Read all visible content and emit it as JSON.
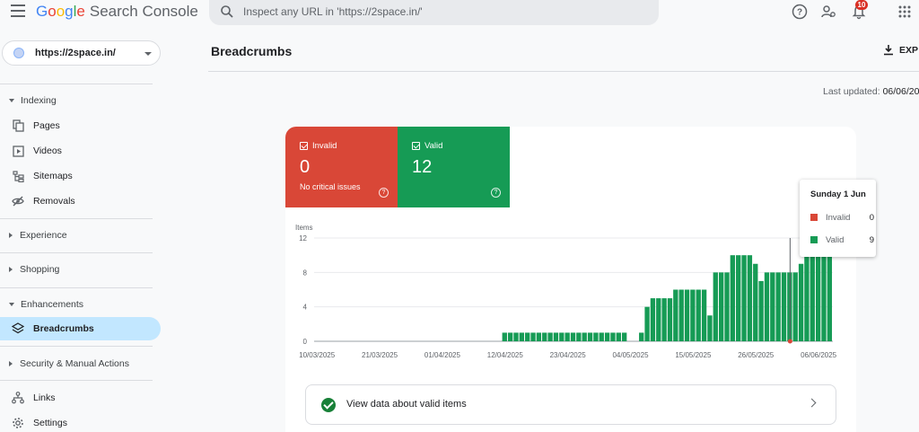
{
  "header": {
    "logo_google": "Google",
    "logo_product": "Search Console",
    "search_placeholder": "Inspect any URL in 'https://2space.in/'",
    "notifications_count": "10"
  },
  "sidebar": {
    "property": "https://2space.in/",
    "sections": {
      "indexing": "Indexing",
      "experience": "Experience",
      "shopping": "Shopping",
      "enhancements": "Enhancements",
      "security": "Security & Manual Actions"
    },
    "items": {
      "pages": "Pages",
      "videos": "Videos",
      "sitemaps": "Sitemaps",
      "removals": "Removals",
      "breadcrumbs": "Breadcrumbs",
      "links": "Links",
      "settings": "Settings"
    }
  },
  "main": {
    "title": "Breadcrumbs",
    "export_label": "EXP",
    "last_updated_label": "Last updated:",
    "last_updated_value": "06/06/20",
    "tiles": {
      "invalid": {
        "label": "Invalid",
        "value": "0",
        "sub": "No critical issues"
      },
      "valid": {
        "label": "Valid",
        "value": "12"
      }
    },
    "tooltip": {
      "date": "Sunday 1 Jun",
      "invalid_label": "Invalid",
      "invalid_value": "0",
      "valid_label": "Valid",
      "valid_value": "9"
    },
    "view_data_label": "View data about valid items"
  },
  "colors": {
    "invalid": "#d94737",
    "valid": "#169b55",
    "accent_active": "#c2e7ff"
  },
  "chart_data": {
    "type": "bar",
    "ylabel": "Items",
    "ylim": [
      0,
      12
    ],
    "yticks": [
      0,
      4,
      8,
      12
    ],
    "xtick_labels": [
      "10/03/2025",
      "21/03/2025",
      "01/04/2025",
      "12/04/2025",
      "23/04/2025",
      "04/05/2025",
      "15/05/2025",
      "26/05/2025",
      "06/06/2025"
    ],
    "start_date": "10/03/2025",
    "series": [
      {
        "name": "Invalid",
        "values": [
          0
        ]
      },
      {
        "name": "Valid",
        "values": [
          0,
          0,
          0,
          0,
          0,
          0,
          0,
          0,
          0,
          0,
          0,
          0,
          0,
          0,
          0,
          0,
          0,
          0,
          0,
          0,
          0,
          0,
          0,
          0,
          0,
          0,
          0,
          0,
          0,
          0,
          0,
          0,
          0,
          1,
          1,
          1,
          1,
          1,
          1,
          1,
          1,
          1,
          1,
          1,
          1,
          1,
          1,
          1,
          1,
          1,
          1,
          1,
          1,
          1,
          1,
          0,
          0,
          1,
          4,
          5,
          5,
          5,
          5,
          6,
          6,
          6,
          6,
          6,
          6,
          3,
          8,
          8,
          8,
          10,
          10,
          10,
          10,
          9,
          7,
          8,
          8,
          8,
          8,
          8,
          8,
          9,
          12,
          10,
          10,
          10,
          10
        ]
      }
    ]
  }
}
